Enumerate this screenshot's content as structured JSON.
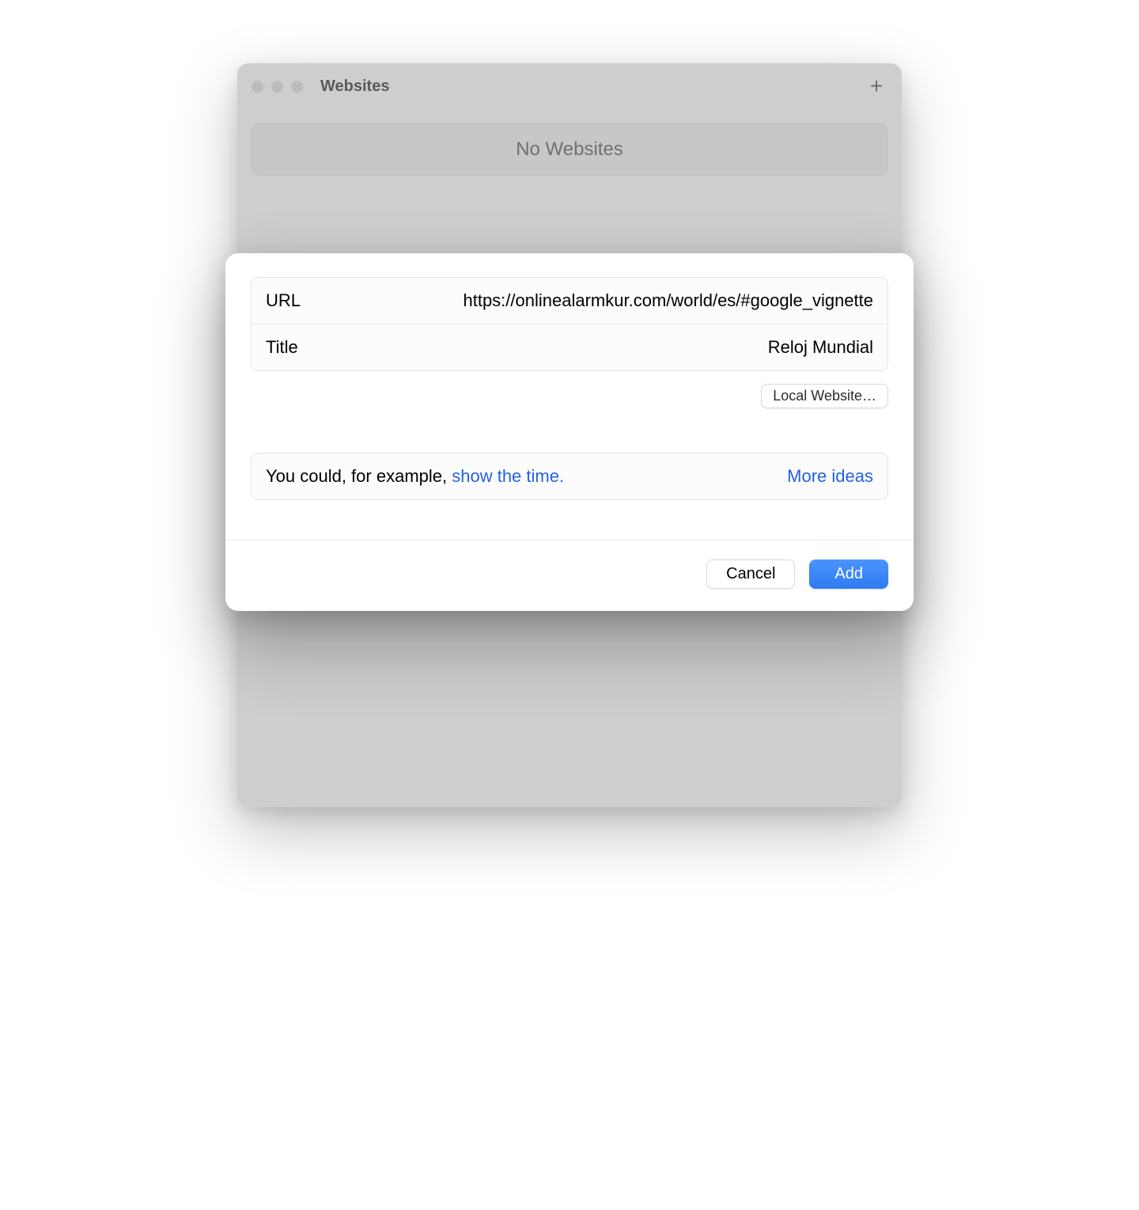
{
  "window": {
    "title": "Websites",
    "empty_message": "No Websites"
  },
  "modal": {
    "url_label": "URL",
    "url_value": "https://onlinealarmkur.com/world/es/#google_vignette",
    "title_label": "Title",
    "title_value": "Reloj Mundial",
    "local_website_label": "Local Website…",
    "hint_prefix": "You could, for example, ",
    "hint_link": "show the time.",
    "more_ideas": "More ideas",
    "cancel_label": "Cancel",
    "add_label": "Add"
  }
}
